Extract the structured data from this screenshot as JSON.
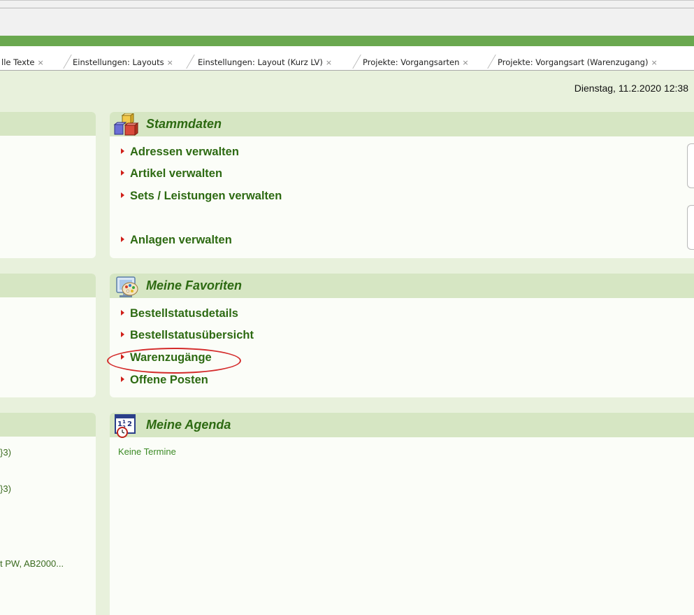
{
  "tabs": [
    {
      "label": "lle Texte"
    },
    {
      "label": "Einstellungen: Layouts"
    },
    {
      "label": "Einstellungen: Layout (Kurz LV)"
    },
    {
      "label": "Projekte: Vorgangsarten"
    },
    {
      "label": "Projekte: Vorgangsart (Warenzugang)"
    }
  ],
  "tab_close_glyph": "×",
  "datetime": "Dienstag, 11.2.2020 12:38",
  "left_column": {
    "items": [
      "}3)",
      "}3)",
      "t PW, AB2000..."
    ]
  },
  "stammdaten": {
    "title": "Stammdaten",
    "icon": "building-blocks-icon",
    "links": [
      "Adressen verwalten",
      "Artikel verwalten",
      "Sets / Leistungen verwalten",
      "Anlagen verwalten"
    ]
  },
  "favoriten": {
    "title": "Meine Favoriten",
    "icon": "palette-monitor-icon",
    "links": [
      "Bestellstatusdetails",
      "Bestellstatusübersicht",
      "Warenzugänge",
      "Offene Posten"
    ],
    "highlighted": "Warenzugänge"
  },
  "agenda": {
    "title": "Meine Agenda",
    "icon": "calendar-clock-icon",
    "empty_text": "Keine Termine"
  },
  "colors": {
    "brand_green": "#6aa84f",
    "header_green": "#d6e6c3",
    "link_green": "#2d6a12",
    "arrow_red": "#d0201a",
    "highlight_red": "#d42b2b"
  }
}
